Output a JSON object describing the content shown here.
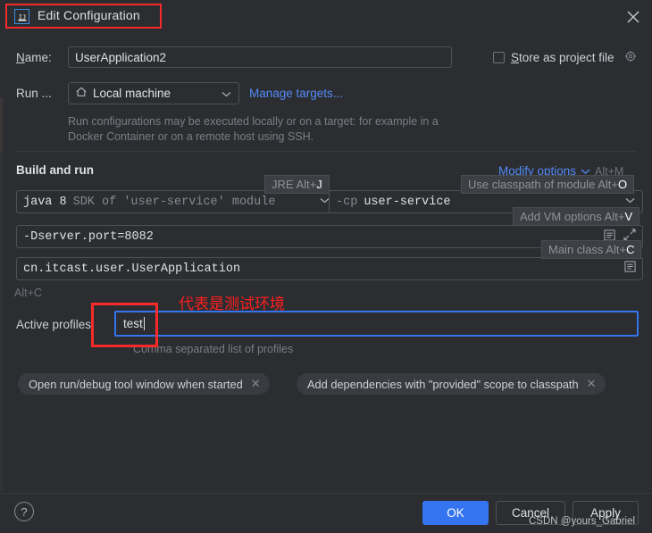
{
  "window": {
    "title": "Edit Configuration",
    "app_icon": "intellij-idea-icon",
    "close_icon": "close-icon"
  },
  "name_row": {
    "label_prefix": "N",
    "label_rest": "ame:",
    "value": "UserApplication2",
    "store_as_project_file": {
      "label_prefix": "S",
      "label_rest": "tore as project file",
      "checked": false,
      "gear_icon": "gear-icon"
    }
  },
  "run_row": {
    "label": "Run ...",
    "target_value": "Local machine",
    "target_icon": "home-icon",
    "manage_targets_link": "Manage targets...",
    "description": "Run configurations may be executed locally or on a target: for example in a Docker Container or on a remote host using SSH."
  },
  "build_and_run": {
    "section_title": "Build and run",
    "modify_options": {
      "label": "Modify options",
      "chevron": "chevron-down-icon",
      "shortcut": "Alt+M"
    },
    "jre": {
      "value_bold": "java 8",
      "value_dim": "SDK of 'user-service' module",
      "chevron": "chevron-down-icon"
    },
    "classpath": {
      "prefix": "-cp",
      "value": "user-service",
      "chevron": "chevron-down-icon"
    },
    "vm_options": {
      "value": "-Dserver.port=8082",
      "icons": [
        "list-icon",
        "expand-icon"
      ]
    },
    "main_class": {
      "value": "cn.itcast.user.UserApplication",
      "icons": [
        "list-icon"
      ]
    },
    "overlays": {
      "jre": {
        "text": "JRE Alt+",
        "key": "J"
      },
      "classpath": {
        "text": "Use classpath of module Alt+",
        "key": "O"
      },
      "vm": {
        "text": "Add VM options Alt+",
        "key": "V"
      },
      "main": {
        "text": "Main class Alt+",
        "key": "C"
      },
      "stray": "Alt+C"
    }
  },
  "active_profiles": {
    "label": "Active profiles:",
    "value": "test",
    "hint": "Comma separated list of profiles"
  },
  "annotations": {
    "chinese_note": "代表是测试环境",
    "box_color": "#f62a2a",
    "note_color": "#ff1f1f"
  },
  "chips": [
    {
      "label": "Open run/debug tool window when started",
      "close_icon": "close-icon"
    },
    {
      "label": "Add dependencies with \"provided\" scope to classpath",
      "close_icon": "close-icon"
    }
  ],
  "footer": {
    "help_icon": "?",
    "ok": "OK",
    "cancel": "Cancel",
    "apply": "Apply"
  },
  "watermark": "CSDN @yours_Gabriel",
  "colors": {
    "background": "#2b2d30",
    "accent_blue": "#3574f0",
    "link_blue": "#548af7",
    "annotation_red": "#f62a2a"
  }
}
